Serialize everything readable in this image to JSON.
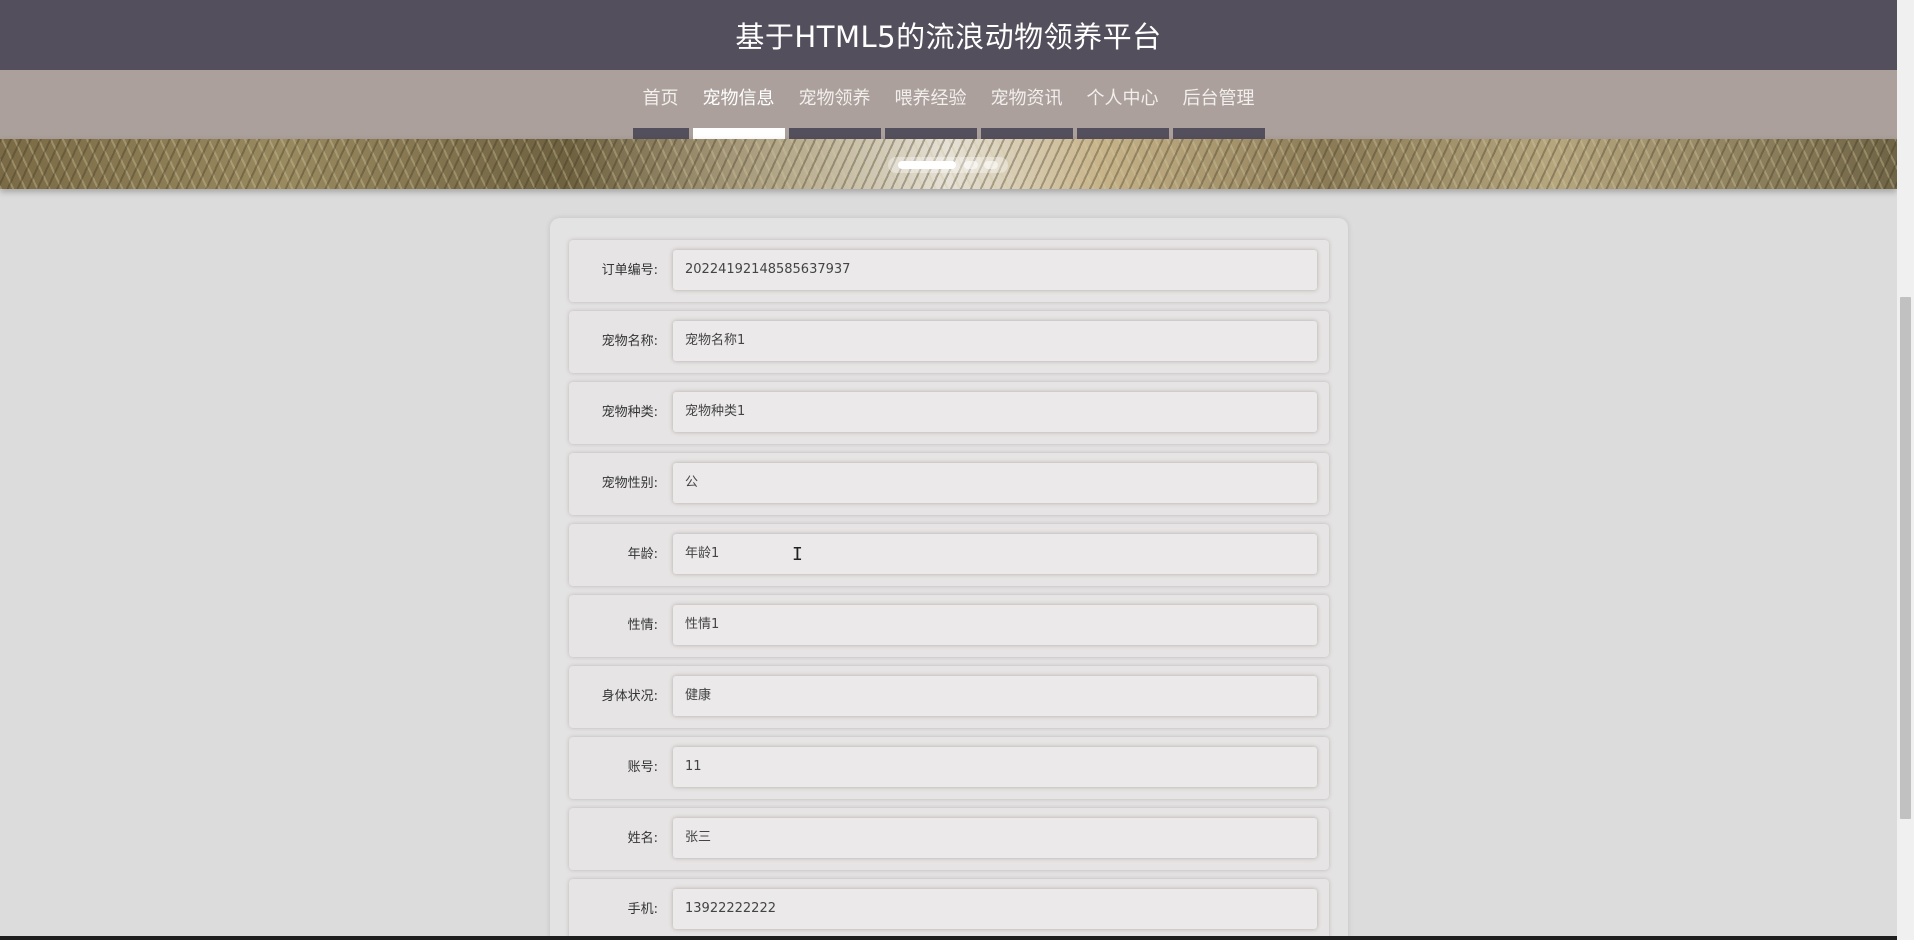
{
  "header": {
    "title": "基于HTML5的流浪动物领养平台"
  },
  "nav": {
    "items": [
      {
        "label": "首页"
      },
      {
        "label": "宠物信息",
        "active": true
      },
      {
        "label": "宠物领养"
      },
      {
        "label": "喂养经验"
      },
      {
        "label": "宠物资讯"
      },
      {
        "label": "个人中心"
      },
      {
        "label": "后台管理"
      }
    ]
  },
  "form": {
    "fields": [
      {
        "label": "订单编号:",
        "value": "20224192148585637937"
      },
      {
        "label": "宠物名称:",
        "value": "宠物名称1"
      },
      {
        "label": "宠物种类:",
        "value": "宠物种类1"
      },
      {
        "label": "宠物性别:",
        "value": "公"
      },
      {
        "label": "年龄:",
        "value": "年龄1"
      },
      {
        "label": "性情:",
        "value": "性情1"
      },
      {
        "label": "身体状况:",
        "value": "健康"
      },
      {
        "label": "账号:",
        "value": "11"
      },
      {
        "label": "姓名:",
        "value": "张三"
      },
      {
        "label": "手机:",
        "value": "13922222222"
      }
    ]
  },
  "cursor": {
    "glyph": "I"
  },
  "colors": {
    "header_bg": "#544f5c",
    "nav_bg": "#aba09b",
    "page_bg": "#dcdcdc",
    "active_bar": "#ffffff"
  }
}
